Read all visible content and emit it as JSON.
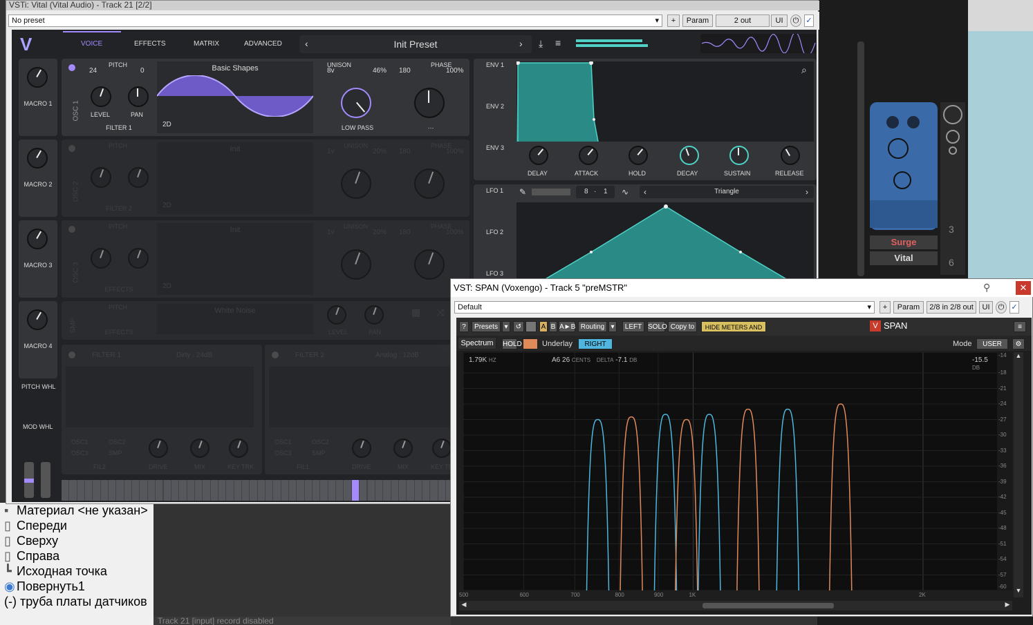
{
  "host": {
    "tree_items": [
      "Материал <не указан>",
      "Спереди",
      "Сверху",
      "Справа",
      "Исходная точка",
      "Повернуть1",
      "(-) труба платы датчиков"
    ],
    "status_text": "Track 21 [input] record disabled",
    "plugins": [
      "Surge",
      "Vital"
    ],
    "track_numbers": [
      "3",
      "6"
    ]
  },
  "vital": {
    "title": "VSTi: Vital (Vital Audio) - Track 21 [2/2]",
    "preset_select": "No preset",
    "plus_label": "+",
    "param_label": "Param",
    "out_label": "2 out",
    "ui_label": "UI",
    "tabs": [
      "VOICE",
      "EFFECTS",
      "MATRIX",
      "ADVANCED"
    ],
    "preset_name": "Init Preset",
    "macros": [
      "MACRO 1",
      "MACRO 2",
      "MACRO 3",
      "MACRO 4"
    ],
    "pitch_whl": "PITCH WHL",
    "mod_whl": "MOD WHL",
    "osc1": {
      "label": "OSC 1",
      "pitch_label": "PITCH",
      "pitch_left": "24",
      "pitch_right": "0",
      "level": "LEVEL",
      "pan": "PAN",
      "route": "FILTER 1",
      "wave": "Basic Shapes",
      "dim": "2D",
      "unison_label": "UNISON",
      "voices": "8v",
      "unison_pct": "46%",
      "phase_label": "PHASE",
      "phase_val": "180",
      "phase_pct": "100%",
      "filter": "LOW PASS",
      "dots": "···"
    },
    "osc2": {
      "label": "OSC 2",
      "pitch_label": "PITCH",
      "route": "FILTER 2",
      "wave": "Init",
      "dim": "2D",
      "unison_label": "UNISON",
      "phase_label": "PHASE",
      "voices": "1v",
      "unison_pct": "20%",
      "phase_val": "180",
      "phase_pct": "100%"
    },
    "osc3": {
      "label": "OSC 3",
      "pitch_label": "PITCH",
      "route": "EFFECTS",
      "wave": "Init",
      "dim": "2D",
      "unison_label": "UNISON",
      "phase_label": "PHASE",
      "voices": "1v",
      "unison_pct": "20%",
      "phase_val": "180",
      "phase_pct": "100%"
    },
    "smp": {
      "label": "SMP",
      "pitch_label": "PITCH",
      "route": "EFFECTS",
      "wave": "White Noise",
      "level": "LEVEL",
      "pan": "PAN"
    },
    "filter1": {
      "label": "FILTER 1",
      "type": "Dirty : 24dB",
      "drive": "DRIVE",
      "mix": "MIX",
      "keytrk": "KEY TRK",
      "sources": [
        "OSC1",
        "OSC2",
        "OSC3",
        "SMP"
      ],
      "route": "FIL2"
    },
    "filter2": {
      "label": "FILTER 2",
      "type": "Analog : 12dB",
      "drive": "DRIVE",
      "mix": "MIX",
      "keytrk": "KEY TR",
      "sources": [
        "OSC1",
        "OSC2",
        "OSC3",
        "SMP"
      ],
      "route": "FIL1"
    },
    "env_tabs": [
      "ENV 1",
      "ENV 2",
      "ENV 3"
    ],
    "env_knobs": [
      "DELAY",
      "ATTACK",
      "HOLD",
      "DECAY",
      "SUSTAIN",
      "RELEASE"
    ],
    "lfo_tabs": [
      "LFO 1",
      "LFO 2",
      "LFO 3"
    ],
    "lfo_rate_num": "8",
    "lfo_rate_den": "1",
    "lfo_shape": "Triangle",
    "accent": "#a38bff",
    "teal": "#4fd1c5"
  },
  "span": {
    "title": "VST: SPAN (Voxengo) - Track 5 \"preMSTR\"",
    "preset_select": "Default",
    "plus_label": "+",
    "param_label": "Param",
    "io_label": "2/8 in 2/8 out",
    "ui_label": "UI",
    "toolbar": {
      "help": "?",
      "presets": "Presets",
      "a": "A",
      "b": "B",
      "ab": "A►B",
      "routing": "Routing",
      "left": "LEFT",
      "solo": "SOLO",
      "copy": "Copy to",
      "hide": "HIDE METERS AND STATS"
    },
    "logo": "SPAN",
    "spectrum_tab": "Spectrum",
    "hold": "HOLD",
    "underlay": "Underlay",
    "right": "RIGHT",
    "mode_label": "Mode",
    "mode_value": "USER",
    "readout": {
      "freq": "1.79K",
      "freq_unit": "HZ",
      "note": "A6",
      "cents": "26",
      "cents_unit": "CENTS",
      "delta": "DELTA",
      "db": "-7.1",
      "db_unit": "DB",
      "level": "-15.5",
      "level_unit": "DB"
    },
    "x_ticks": [
      "500",
      "600",
      "700",
      "800",
      "900",
      "1K",
      "2K"
    ],
    "y_ticks": [
      "-14",
      "-18",
      "-21",
      "-24",
      "-27",
      "-30",
      "-33",
      "-36",
      "-39",
      "-42",
      "-45",
      "-48",
      "-51",
      "-54",
      "-57",
      "-60"
    ],
    "peaks": [
      {
        "color": "#4fb6e0",
        "freq": 750,
        "level_db": -27
      },
      {
        "color": "#e08a5a",
        "freq": 830,
        "level_db": -26.5
      },
      {
        "color": "#4fb6e0",
        "freq": 920,
        "level_db": -26
      },
      {
        "color": "#e08a5a",
        "freq": 980,
        "level_db": -27
      },
      {
        "color": "#4fb6e0",
        "freq": 1050,
        "level_db": -26
      },
      {
        "color": "#e08a5a",
        "freq": 1180,
        "level_db": -25
      },
      {
        "color": "#4fb6e0",
        "freq": 1330,
        "level_db": -25
      },
      {
        "color": "#e08a5a",
        "freq": 1560,
        "level_db": -24
      }
    ]
  }
}
